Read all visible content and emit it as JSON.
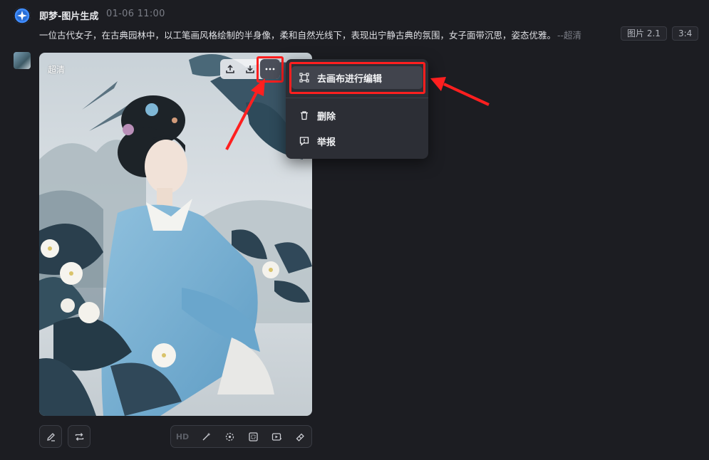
{
  "header": {
    "app_name": "即梦-图片生成",
    "timestamp": "01-06  11:00",
    "prompt": "一位古代女子，在古典园林中，以工笔画风格绘制的半身像，柔和自然光线下，表现出宁静古典的氛围，女子面带沉思，姿态优雅。",
    "prompt_suffix": "--超清",
    "model_tag": "图片 2.1",
    "ratio_tag": "3:4"
  },
  "image": {
    "quality_badge": "超清",
    "toolbar_icons": [
      "upload-icon",
      "download-icon",
      "more-icon"
    ]
  },
  "context_menu": {
    "items": [
      {
        "label": "去画布进行编辑",
        "icon": "canvas-edit-icon"
      },
      {
        "label": "删除",
        "icon": "trash-icon"
      },
      {
        "label": "举报",
        "icon": "report-icon"
      }
    ]
  },
  "bottom_toolbar": {
    "hd_label": "HD",
    "icons": [
      "pencil-icon",
      "regenerate-icon",
      "magic-wand-icon",
      "dashed-circle-icon",
      "expand-frame-icon",
      "video-icon",
      "eraser-icon"
    ]
  },
  "colors": {
    "background": "#1c1d22",
    "menu_bg": "#2c2e35",
    "highlight": "#ff1f1f",
    "accent": "#3f8cff"
  }
}
